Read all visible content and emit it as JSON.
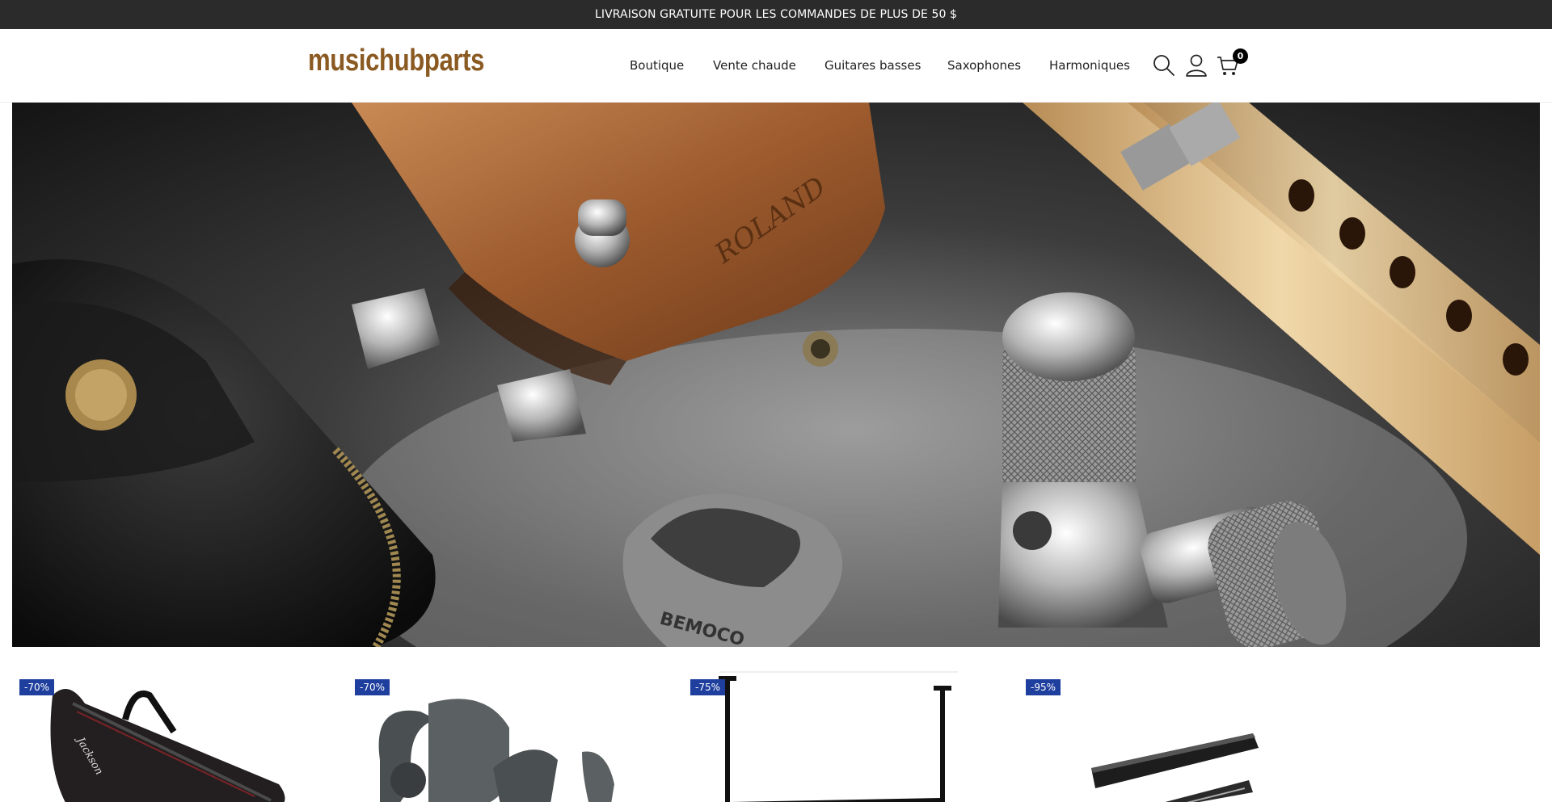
{
  "announcement": {
    "text": "LIVRAISON GRATUITE POUR LES COMMANDES DE PLUS DE 50 $"
  },
  "header": {
    "logo": "musichubparts",
    "nav": [
      {
        "label": "Boutique"
      },
      {
        "label": "Vente chaude"
      },
      {
        "label": "Guitares basses"
      },
      {
        "label": "Saxophones"
      },
      {
        "label": "Harmoniques"
      }
    ],
    "icons": [
      "search-icon",
      "account-icon",
      "cart-icon"
    ],
    "cart_count": "0"
  },
  "hero": {
    "image": "music-accessories-photo",
    "text_on_image": {
      "headstock_logo": "ROLAND",
      "pick_brand": "BEMOCO"
    }
  },
  "products": [
    {
      "badge": "-70%",
      "image": "guitar-gig-bag"
    },
    {
      "badge": "-70%",
      "image": "instrument-clip-holders"
    },
    {
      "badge": "-75%",
      "image": "folding-stand"
    },
    {
      "badge": "-95%",
      "image": "flat-instrument-case"
    }
  ],
  "colors": {
    "announcement_bg": "#2b2b2b",
    "logo": "#8a5a22",
    "badge_bg": "#1f3f9e"
  }
}
